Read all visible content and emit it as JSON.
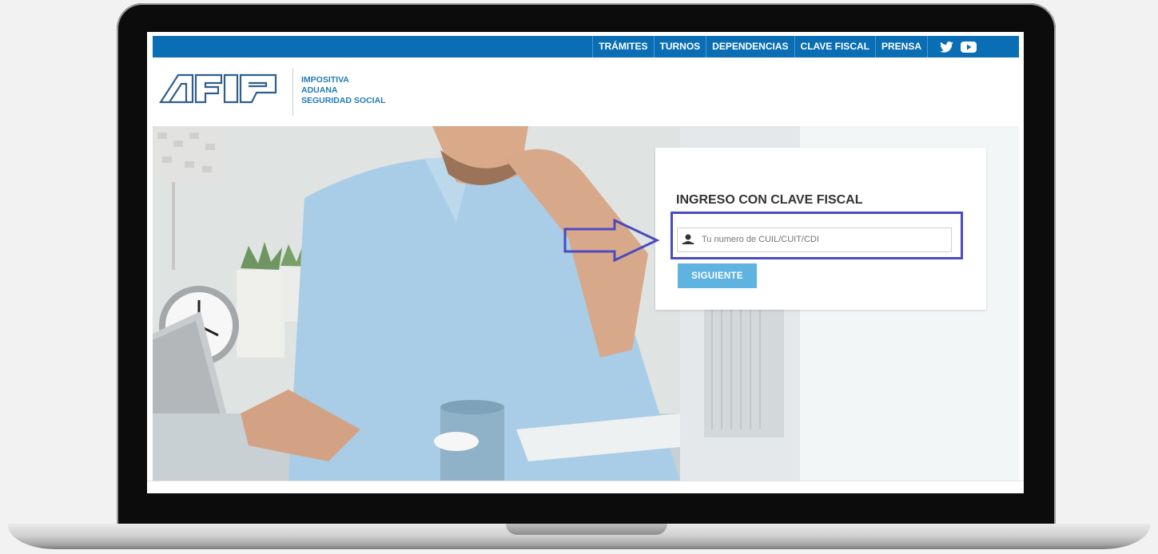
{
  "nav": {
    "items": [
      {
        "label": "TRÁMITES"
      },
      {
        "label": "TURNOS"
      },
      {
        "label": "DEPENDENCIAS"
      },
      {
        "label": "CLAVE FISCAL"
      },
      {
        "label": "PRENSA"
      }
    ],
    "social": [
      {
        "icon": "twitter-icon"
      },
      {
        "icon": "youtube-icon"
      }
    ]
  },
  "header": {
    "logo_text": "AFIP",
    "tagline": [
      "IMPOSITIVA",
      "ADUANA",
      "SEGURIDAD SOCIAL"
    ]
  },
  "login": {
    "title": "INGRESO CON CLAVE FISCAL",
    "cuit_placeholder": "Tu numero de CUIL/CUIT/CDI",
    "submit_label": "SIGUIENTE"
  },
  "colors": {
    "brand_blue": "#0a6eb4",
    "button": "#5fb3e0",
    "annotation": "#4b4bbf"
  }
}
